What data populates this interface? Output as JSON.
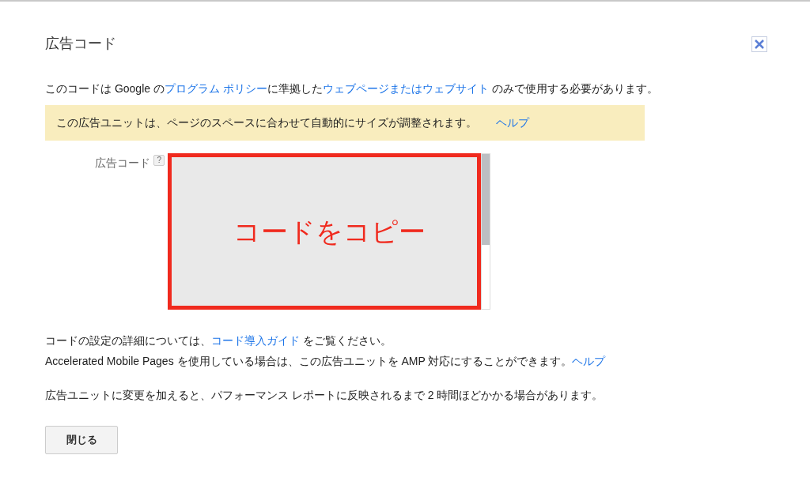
{
  "dialog": {
    "title": "広告コード"
  },
  "notice": [
    {
      "text": "このコードは Google の",
      "link": false
    },
    {
      "text": "プログラム ポリシー",
      "link": true
    },
    {
      "text": "に準拠した",
      "link": false
    },
    {
      "text": "ウェブページまたはウェブサイト",
      "link": true
    },
    {
      "text": " のみで使用する必要があります。",
      "link": false
    }
  ],
  "alert": {
    "text": "この広告ユニットは、ページのスペースに合わせて自動的にサイズが調整されます。",
    "link": "ヘルプ"
  },
  "field": {
    "label": "広告コード",
    "help": "?",
    "annotation": "コードをコピー"
  },
  "info_lines": [
    [
      {
        "text": "コードの設定の詳細については、",
        "link": false
      },
      {
        "text": "コード導入ガイド",
        "link": true
      },
      {
        "text": " をご覧ください。",
        "link": false
      }
    ],
    [
      {
        "text": "Accelerated Mobile Pages を使用している場合は、この広告ユニットを AMP 対応にすることができます。",
        "link": false
      },
      {
        "text": "ヘルプ",
        "link": true
      }
    ]
  ],
  "footer_note": "広告ユニットに変更を加えると、パフォーマンス レポートに反映されるまで 2 時間ほどかかる場合があります。",
  "buttons": [
    "閉じる"
  ]
}
